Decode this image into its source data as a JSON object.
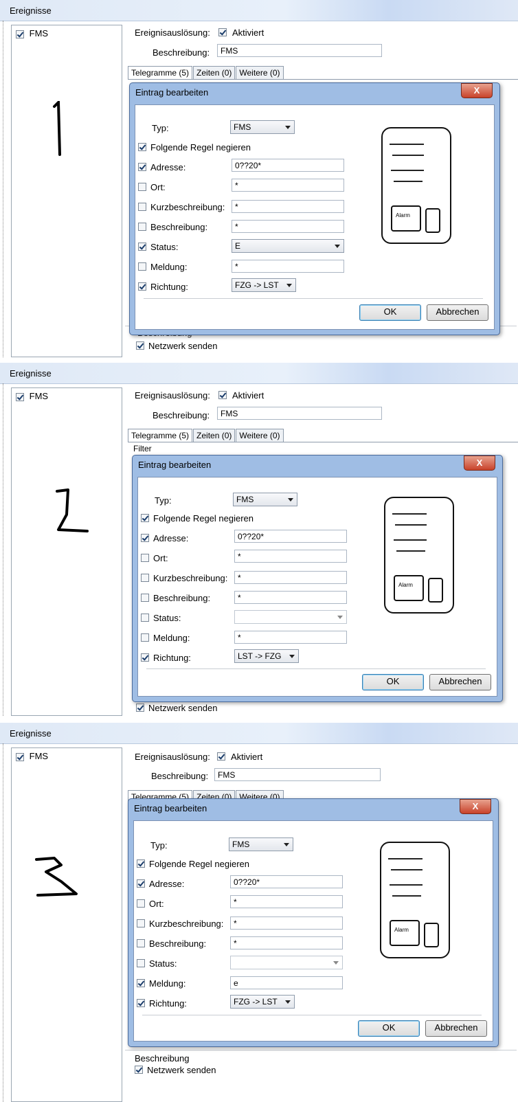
{
  "window_title": "Ereignisse",
  "tree_item": "FMS",
  "labels": {
    "trigger": "Ereignisauslösung:",
    "activated": "Aktiviert",
    "description": "Beschreibung:",
    "description_value": "FMS",
    "tab_telegrams": "Telegramme (5)",
    "tab_times": "Zeiten (0)",
    "tab_more": "Weitere (0)",
    "filter": "Filter",
    "beschreibung_group": "Beschreibung",
    "network": "Netzwerk senden"
  },
  "dialog": {
    "title": "Eintrag bearbeiten",
    "close": "X",
    "typ_label": "Typ:",
    "typ_value": "FMS",
    "negate_label": "Folgende Regel negieren",
    "adresse_label": "Adresse:",
    "ort_label": "Ort:",
    "kurz_label": "Kurzbeschreibung:",
    "beschr_label": "Beschreibung:",
    "status_label": "Status:",
    "meldung_label": "Meldung:",
    "richtung_label": "Richtung:",
    "ok": "OK",
    "cancel": "Abbrechen",
    "pager_alarm": "Alarm"
  },
  "panels": [
    {
      "number": "1",
      "adresse": "0??20*",
      "ort": "*",
      "kurz": "*",
      "beschr": "*",
      "status": "E",
      "meldung": "*",
      "richtung": "FZG -> LST",
      "checks": {
        "negate": true,
        "adresse": true,
        "ort": false,
        "kurz": false,
        "beschr": false,
        "status": true,
        "meldung": false,
        "richtung": true
      }
    },
    {
      "number": "2",
      "adresse": "0??20*",
      "ort": "*",
      "kurz": "*",
      "beschr": "*",
      "status": "",
      "meldung": "*",
      "richtung": "LST -> FZG",
      "checks": {
        "negate": true,
        "adresse": true,
        "ort": false,
        "kurz": false,
        "beschr": false,
        "status": false,
        "meldung": false,
        "richtung": true
      }
    },
    {
      "number": "3",
      "adresse": "0??20*",
      "ort": "*",
      "kurz": "*",
      "beschr": "*",
      "status": "",
      "meldung": "e",
      "richtung": "FZG -> LST",
      "checks": {
        "negate": true,
        "adresse": true,
        "ort": false,
        "kurz": false,
        "beschr": false,
        "status": false,
        "meldung": true,
        "richtung": true
      }
    }
  ]
}
